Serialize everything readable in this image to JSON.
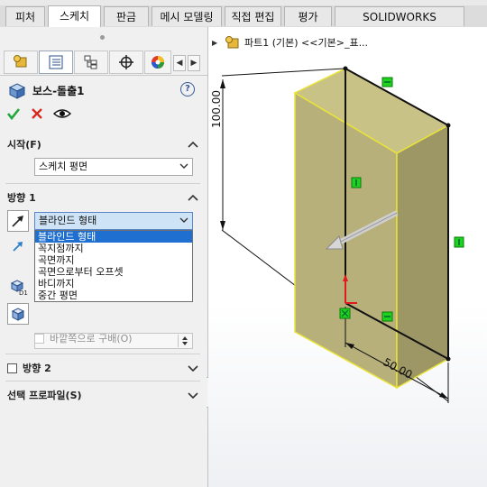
{
  "tabs": [
    "피처",
    "스케치",
    "판금",
    "메시 모델링",
    "직접 편집",
    "평가",
    "SOLIDWORKS Inspection"
  ],
  "active_tab": "스케치",
  "property_manager": {
    "panel_tabs": [
      "feature-manager",
      "property-manager",
      "configuration-manager",
      "dimxpert-manager",
      "display-manager"
    ],
    "title": "보스-돌출1",
    "help_icon": "help-icon",
    "start": {
      "label": "시작(F)",
      "value": "스케치 평면"
    },
    "direction1": {
      "label": "방향 1",
      "end_condition": "블라인드 형태",
      "options": [
        "블라인드 형태",
        "꼭지점까지",
        "곡면까지",
        "곡면으로부터 오프셋",
        "바디까지",
        "중간 평면"
      ],
      "selected_index": 0,
      "reverse_label": "바깥쪽으로 구배(O)"
    },
    "direction2": {
      "label": "방향 2"
    },
    "selected_contours": {
      "label": "선택 프로파일(S)"
    }
  },
  "graphics": {
    "tree_label": "파트1 (기본) <<기본>_표...",
    "dim_height": "100.00",
    "dim_width": "50.00",
    "colors": {
      "body_front": "#b7b07a",
      "body_side": "#9d9766",
      "edge_yellow": "#e9e33a",
      "handle_green": "#1fd21f",
      "accent_blue": "#1f6fd0"
    }
  }
}
